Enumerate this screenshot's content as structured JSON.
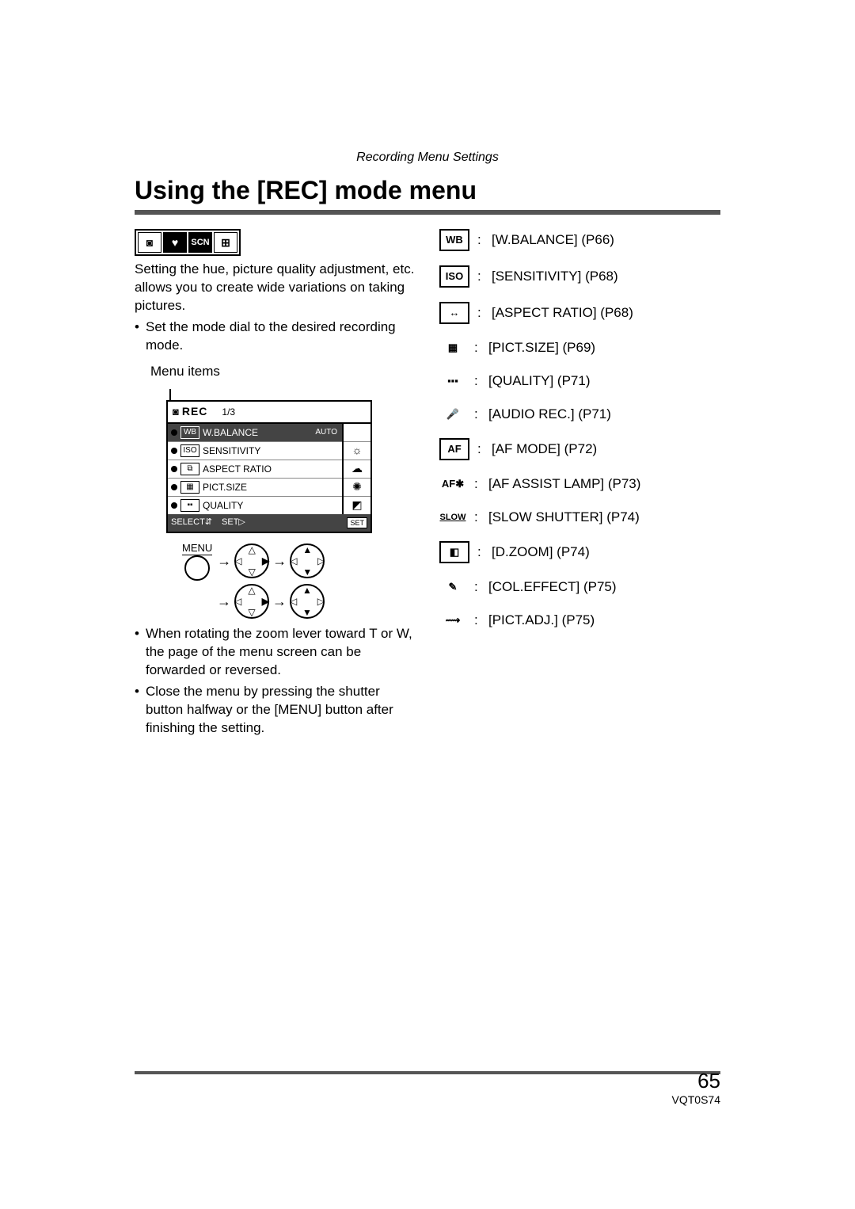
{
  "header": "Recording Menu Settings",
  "title": "Using the [REC] mode menu",
  "left": {
    "intro": "Setting the hue, picture quality adjustment, etc. allows you to create wide variations on taking pictures.",
    "bullet1": "Set the mode dial to the desired recording mode.",
    "menu_items_label": "Menu items",
    "lcd": {
      "rec": "REC",
      "page": "1/3",
      "rows": [
        {
          "icon": "WB",
          "label": "W.BALANCE",
          "auto": "AUTO",
          "hilite": true
        },
        {
          "icon": "ISO",
          "label": "SENSITIVITY"
        },
        {
          "icon": "⧉",
          "label": "ASPECT RATIO"
        },
        {
          "icon": "▦",
          "label": "PICT.SIZE"
        },
        {
          "icon": "▪▪",
          "label": "QUALITY"
        }
      ],
      "side": [
        "",
        "☼",
        "☁",
        "✺",
        "◩"
      ],
      "bottom_select": "SELECT",
      "bottom_set": "SET",
      "bottom_badge": "SET"
    },
    "nav_menu_label": "MENU",
    "bullet2": "When rotating the zoom lever toward T or W, the page of the menu screen can be forwarded or reversed.",
    "bullet3": "Close the menu by pressing the shutter button halfway or the [MENU] button after finishing the setting."
  },
  "right": {
    "items": [
      {
        "icon": "WB",
        "box": true,
        "label": "[W.BALANCE] (P66)"
      },
      {
        "icon": "ISO",
        "box": true,
        "label": "[SENSITIVITY] (P68)"
      },
      {
        "icon": "↔",
        "box": true,
        "label": "[ASPECT RATIO] (P68)"
      },
      {
        "icon": "▦",
        "box": false,
        "label": "[PICT.SIZE] (P69)"
      },
      {
        "icon": "▪▪▪",
        "box": false,
        "label": "[QUALITY] (P71)"
      },
      {
        "icon": "🎤",
        "box": false,
        "label": "[AUDIO REC.] (P71)"
      },
      {
        "icon": "AF",
        "box": true,
        "label": "[AF MODE] (P72)"
      },
      {
        "icon": "AF✱",
        "box": false,
        "label": "[AF ASSIST LAMP] (P73)"
      },
      {
        "icon": "SLOW",
        "box": false,
        "label": "[SLOW SHUTTER] (P74)"
      },
      {
        "icon": "◧",
        "box": true,
        "label": "[D.ZOOM] (P74)"
      },
      {
        "icon": "✎",
        "box": false,
        "label": "[COL.EFFECT] (P75)"
      },
      {
        "icon": "⟿",
        "box": false,
        "label": "[PICT.ADJ.] (P75)"
      }
    ]
  },
  "footer": {
    "page_number": "65",
    "doc_id": "VQT0S74"
  }
}
